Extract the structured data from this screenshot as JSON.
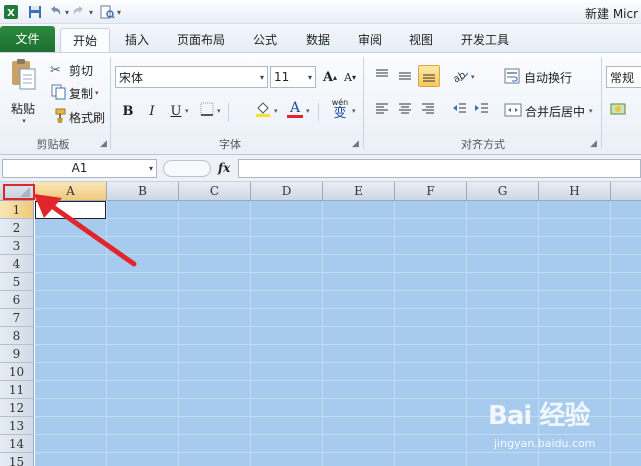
{
  "window": {
    "title": "新建 Micr"
  },
  "ribbon_tabs": [
    {
      "label": "文件"
    },
    {
      "label": "开始"
    },
    {
      "label": "插入"
    },
    {
      "label": "页面布局"
    },
    {
      "label": "公式"
    },
    {
      "label": "数据"
    },
    {
      "label": "审阅"
    },
    {
      "label": "视图"
    },
    {
      "label": "开发工具"
    }
  ],
  "clipboard": {
    "paste_label": "粘贴",
    "cut_label": "剪切",
    "copy_label": "复制",
    "format_painter_label": "格式刷",
    "group_label": "剪贴板"
  },
  "font": {
    "name": "宋体",
    "size": "11",
    "bold": "B",
    "italic": "I",
    "underline": "U",
    "grow": "A",
    "shrink": "A",
    "font_color": "A",
    "phonetic": "wén",
    "phonetic_char": "变",
    "group_label": "字体"
  },
  "alignment": {
    "wrap_text_label": "自动换行",
    "merge_center_label": "合并后居中",
    "group_label": "对齐方式"
  },
  "number": {
    "format": "常规"
  },
  "formula_bar": {
    "name_box": "A1",
    "fx": "fx",
    "formula": ""
  },
  "grid": {
    "columns": [
      "A",
      "B",
      "C",
      "D",
      "E",
      "F",
      "G",
      "H"
    ],
    "rows": [
      "1",
      "2",
      "3",
      "4",
      "5",
      "6",
      "7",
      "8",
      "9",
      "10",
      "11",
      "12",
      "13",
      "14",
      "15"
    ]
  },
  "watermark": {
    "brand": "Bai 经验",
    "url": "jingyan.baidu.com"
  },
  "colors": {
    "selection": "#a6cbef",
    "file_tab": "#2b8a3e",
    "annotation": "#e0262a"
  }
}
